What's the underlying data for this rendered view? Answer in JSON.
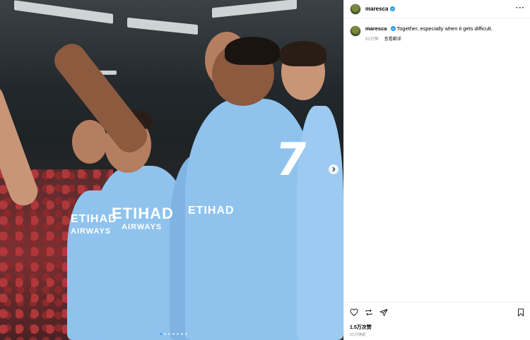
{
  "post": {
    "username": "maresca",
    "caption_user": "maresca",
    "caption": "Together, especially when it gets difficult.",
    "time_ago": "51分钟",
    "translate_label": "查看翻译",
    "likes": "1.5万次赞",
    "posted_ago": "51分钟前",
    "more_label": "···"
  },
  "media": {
    "sponsor_main": "ETIHAD",
    "sponsor_sub": "AIRWAYS",
    "jersey_number": "7",
    "carousel_count": 7,
    "active_slide": 1
  },
  "icons": {
    "like": "heart-icon",
    "repost": "repost-icon",
    "share": "send-icon",
    "save": "bookmark-icon",
    "next": "chevron-right-icon",
    "verified": "verified-badge-icon",
    "more": "more-options-icon"
  },
  "colors": {
    "verified": "#1d9bf0",
    "muted_text": "#8e8e8e",
    "jersey": "#8fc3ee"
  }
}
